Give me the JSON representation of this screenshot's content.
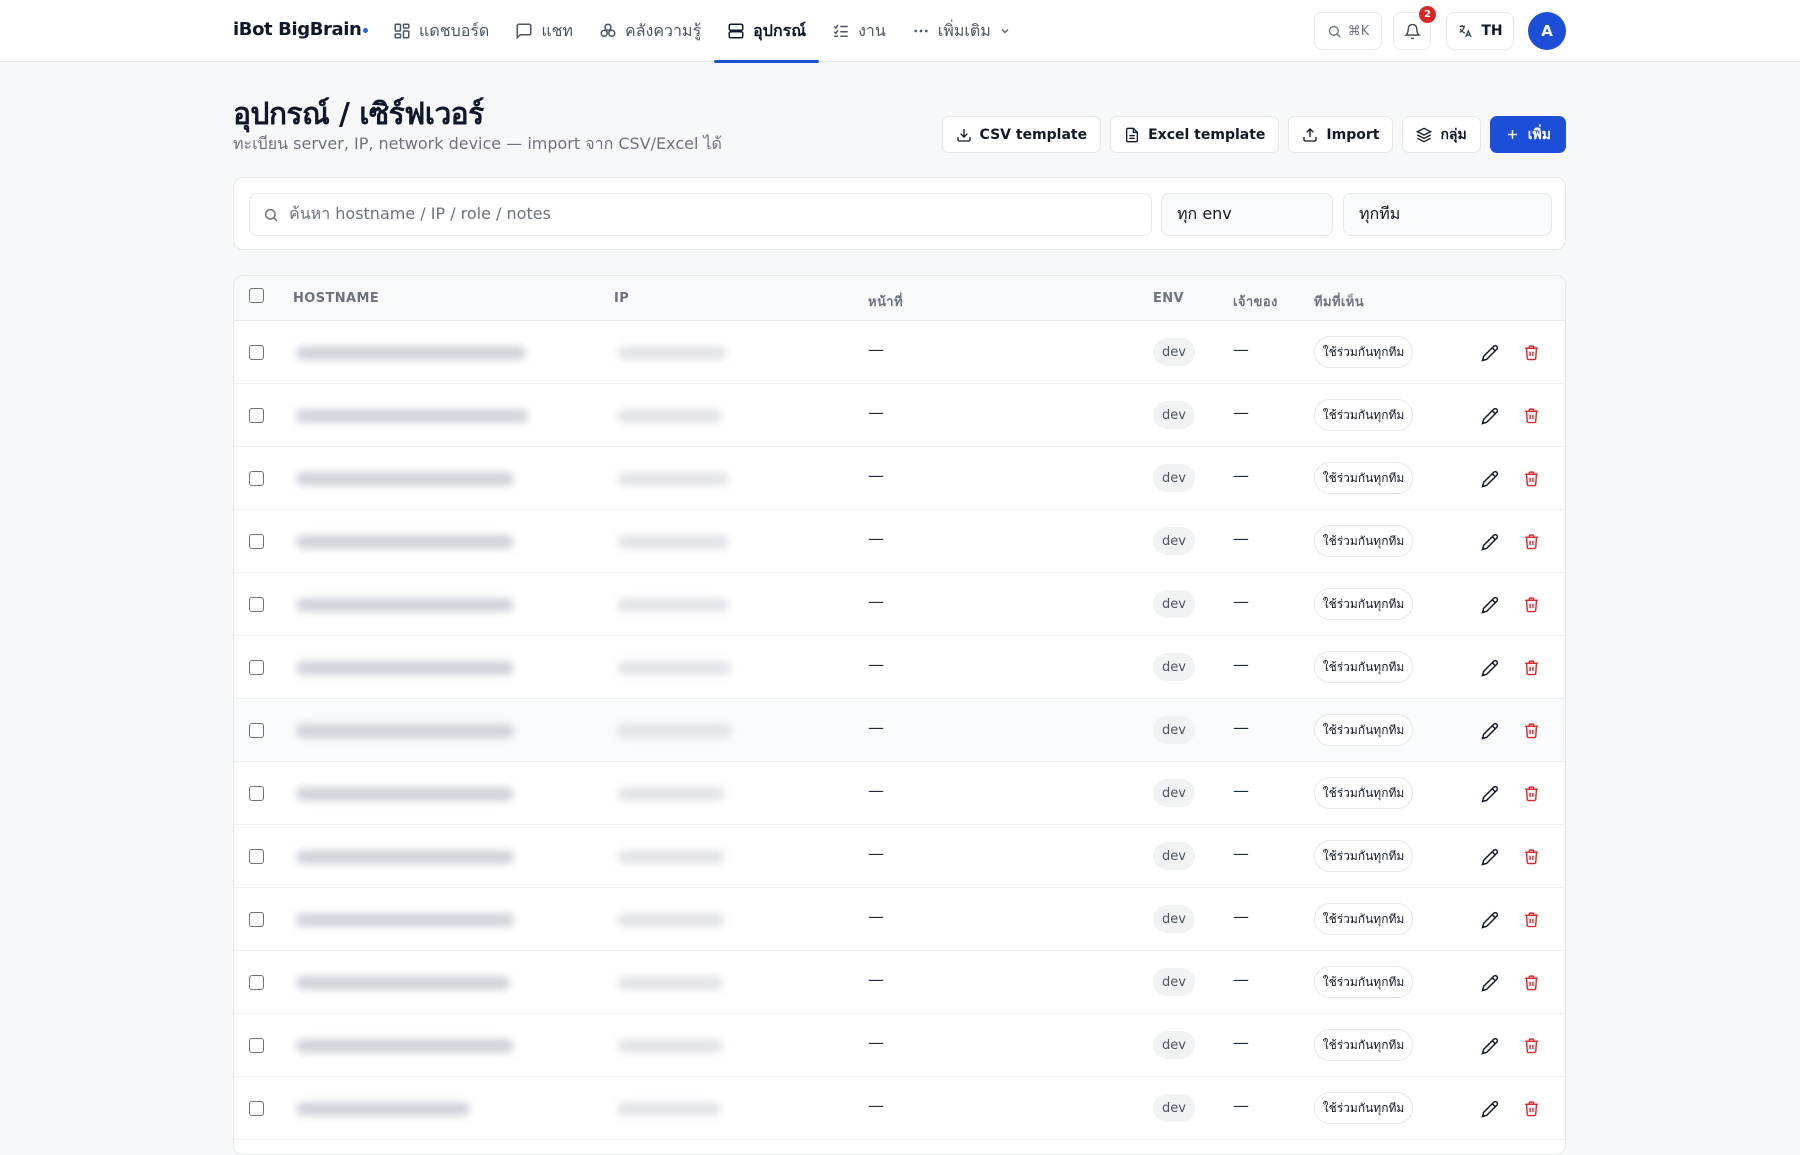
{
  "app": {
    "brand": "iBot BigBrain"
  },
  "nav": [
    {
      "label": "แดชบอร์ด",
      "icon": "dashboard-icon",
      "active": false
    },
    {
      "label": "แชท",
      "icon": "chat-icon",
      "active": false
    },
    {
      "label": "คลังความรู้",
      "icon": "knowledge-icon",
      "active": false
    },
    {
      "label": "อุปกรณ์",
      "icon": "server-icon",
      "active": true
    },
    {
      "label": "งาน",
      "icon": "tasks-icon",
      "active": false
    },
    {
      "label": "เพิ่มเติม",
      "icon": "more-icon",
      "active": false
    }
  ],
  "topbar": {
    "search_shortcut": "⌘K",
    "notifications_count": "2",
    "language": "TH",
    "avatar_initial": "A"
  },
  "page": {
    "title": "อุปกรณ์ / เซิร์ฟเวอร์",
    "subtitle": "ทะเบียน server, IP, network device — import จาก CSV/Excel ได้"
  },
  "actions": {
    "csv_template": "CSV template",
    "excel_template": "Excel template",
    "import": "Import",
    "groups": "กลุ่ม",
    "add": "เพิ่ม"
  },
  "filters": {
    "search_placeholder": "ค้นหา hostname / IP / role / notes",
    "env_selected": "ทุก env",
    "team_selected": "ทุกทีม"
  },
  "table": {
    "columns": {
      "hostname": "HOSTNAME",
      "ip": "IP",
      "role": "หน้าที่",
      "env": "ENV",
      "owner": "เจ้าของ",
      "visible_to": "ทีมที่เห็น"
    },
    "rows": [
      {
        "role": "—",
        "env": "dev",
        "owner": "—",
        "visible_to": "ใช้ร่วมกันทุกทีม"
      },
      {
        "role": "—",
        "env": "dev",
        "owner": "—",
        "visible_to": "ใช้ร่วมกันทุกทีม"
      },
      {
        "role": "—",
        "env": "dev",
        "owner": "—",
        "visible_to": "ใช้ร่วมกันทุกทีม"
      },
      {
        "role": "—",
        "env": "dev",
        "owner": "—",
        "visible_to": "ใช้ร่วมกันทุกทีม"
      },
      {
        "role": "—",
        "env": "dev",
        "owner": "—",
        "visible_to": "ใช้ร่วมกันทุกทีม"
      },
      {
        "role": "—",
        "env": "dev",
        "owner": "—",
        "visible_to": "ใช้ร่วมกันทุกทีม"
      },
      {
        "role": "—",
        "env": "dev",
        "owner": "—",
        "visible_to": "ใช้ร่วมกันทุกทีม"
      },
      {
        "role": "—",
        "env": "dev",
        "owner": "—",
        "visible_to": "ใช้ร่วมกันทุกทีม"
      },
      {
        "role": "—",
        "env": "dev",
        "owner": "—",
        "visible_to": "ใช้ร่วมกันทุกทีม"
      },
      {
        "role": "—",
        "env": "dev",
        "owner": "—",
        "visible_to": "ใช้ร่วมกันทุกทีม"
      },
      {
        "role": "—",
        "env": "dev",
        "owner": "—",
        "visible_to": "ใช้ร่วมกันทุกทีม"
      },
      {
        "role": "—",
        "env": "dev",
        "owner": "—",
        "visible_to": "ใช้ร่วมกันทุกทีม"
      },
      {
        "role": "—",
        "env": "dev",
        "owner": "—",
        "visible_to": "ใช้ร่วมกันทุกทีม"
      }
    ]
  },
  "colors": {
    "accent": "#1d4ed8",
    "danger": "#dc2626",
    "background": "#f7f8fa"
  }
}
